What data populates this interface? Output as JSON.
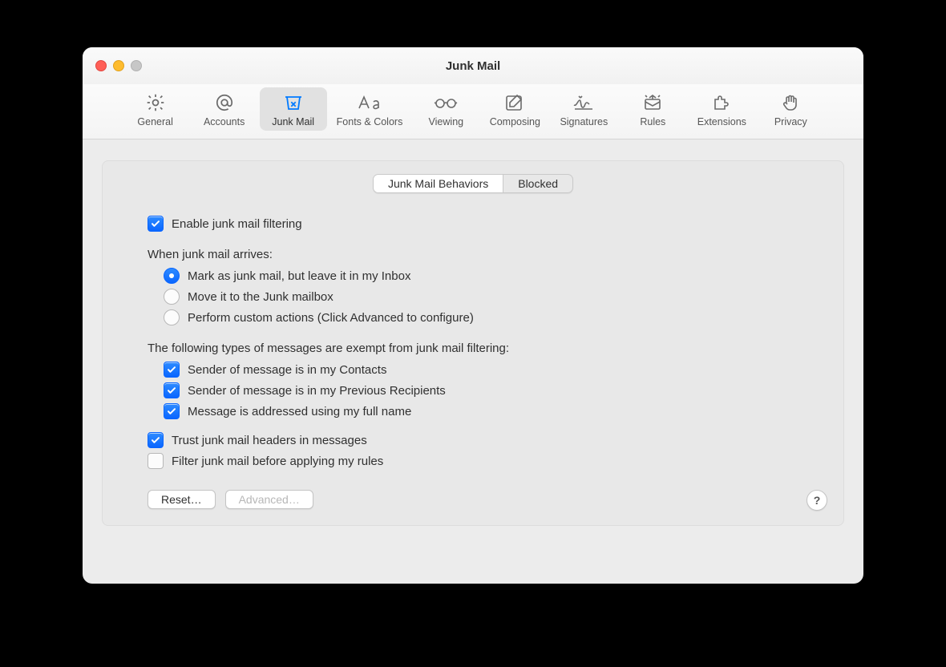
{
  "window": {
    "title": "Junk Mail"
  },
  "toolbar": {
    "items": [
      {
        "id": "general",
        "label": "General"
      },
      {
        "id": "accounts",
        "label": "Accounts"
      },
      {
        "id": "junk",
        "label": "Junk Mail",
        "selected": true
      },
      {
        "id": "fonts",
        "label": "Fonts & Colors"
      },
      {
        "id": "viewing",
        "label": "Viewing"
      },
      {
        "id": "composing",
        "label": "Composing"
      },
      {
        "id": "signatures",
        "label": "Signatures"
      },
      {
        "id": "rules",
        "label": "Rules"
      },
      {
        "id": "extensions",
        "label": "Extensions"
      },
      {
        "id": "privacy",
        "label": "Privacy"
      }
    ]
  },
  "segments": {
    "behaviors": "Junk Mail Behaviors",
    "blocked": "Blocked",
    "active": "behaviors"
  },
  "enable": {
    "label": "Enable junk mail filtering",
    "checked": true
  },
  "arrives": {
    "heading": "When junk mail arrives:",
    "options": [
      {
        "label": "Mark as junk mail, but leave it in my Inbox",
        "selected": true
      },
      {
        "label": "Move it to the Junk mailbox",
        "selected": false
      },
      {
        "label": "Perform custom actions (Click Advanced to configure)",
        "selected": false
      }
    ]
  },
  "exempt": {
    "heading": "The following types of messages are exempt from junk mail filtering:",
    "options": [
      {
        "label": "Sender of message is in my Contacts",
        "checked": true
      },
      {
        "label": "Sender of message is in my Previous Recipients",
        "checked": true
      },
      {
        "label": "Message is addressed using my full name",
        "checked": true
      }
    ]
  },
  "trust": {
    "label": "Trust junk mail headers in messages",
    "checked": true
  },
  "filter": {
    "label": "Filter junk mail before applying my rules",
    "checked": false
  },
  "buttons": {
    "reset": "Reset…",
    "advanced": "Advanced…"
  },
  "help": "?"
}
